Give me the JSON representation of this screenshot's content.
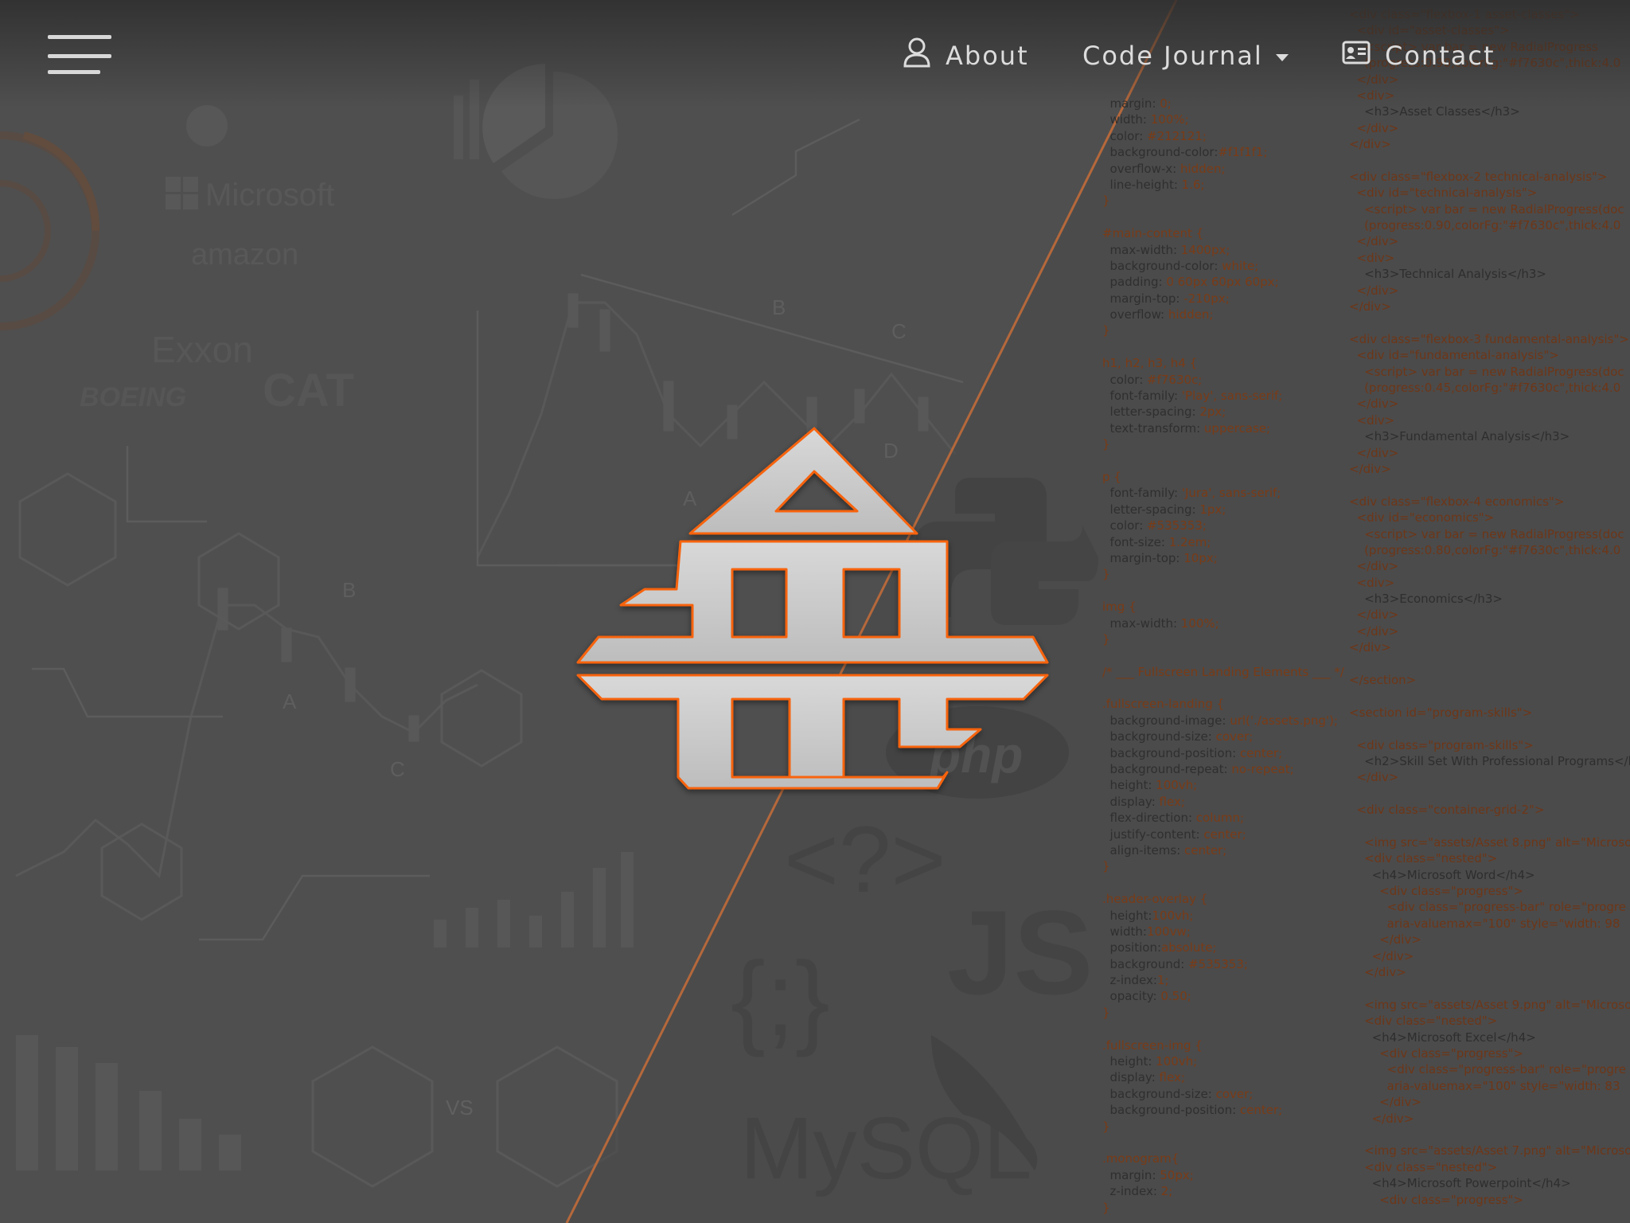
{
  "nav": {
    "menu_icon": "hamburger-menu-icon",
    "items": [
      {
        "label": "About",
        "icon": "user-icon"
      },
      {
        "label": "Code Journal",
        "icon": "chevron-down-icon"
      },
      {
        "label": "Contact",
        "icon": "contact-card-icon"
      }
    ]
  },
  "brand": {
    "monogram_icon": "site-monogram-logo",
    "accent_color": "#f7630c",
    "logo_fill": "#cfcfcf"
  },
  "background": {
    "company_logos": [
      "Microsoft",
      "amazon",
      "Exxon",
      "BOEING",
      "CAT"
    ],
    "tech_logos": [
      "python-logo",
      "php-logo",
      "js-logo",
      "mysql-logo",
      "php-tag-logo",
      "braces-logo"
    ],
    "tech_labels": {
      "php": "php",
      "php_tag": "<?>",
      "braces": "{;}",
      "js": "JS",
      "mysql": "MySQL"
    },
    "chart_labels": [
      "B",
      "A",
      "C",
      "B",
      "A",
      "C",
      "D",
      "D",
      "VS"
    ]
  },
  "css_code": [
    [
      "",
      "margin: ",
      "0;"
    ],
    [
      "",
      "width: ",
      "100%;"
    ],
    [
      "",
      "color: ",
      "#212121;"
    ],
    [
      "",
      "background-color:",
      "#f1f1f1;"
    ],
    [
      "",
      "overflow-x: ",
      "hidden;"
    ],
    [
      "",
      "line-height: ",
      "1.6;"
    ],
    [
      "}",
      "",
      ""
    ],
    [
      "",
      "",
      ""
    ],
    [
      "#main-content {",
      "",
      ""
    ],
    [
      "",
      "max-width: ",
      "1400px;"
    ],
    [
      "",
      "background-color: ",
      "white;"
    ],
    [
      "",
      "padding: ",
      "0 60px 60px 60px;"
    ],
    [
      "",
      "margin-top: ",
      "-210px;"
    ],
    [
      "",
      "overflow: ",
      "hidden;"
    ],
    [
      "}",
      "",
      ""
    ],
    [
      "",
      "",
      ""
    ],
    [
      "h1, h2, h3, h4 {",
      "",
      ""
    ],
    [
      "",
      "color: ",
      "#f7630c;"
    ],
    [
      "",
      "font-family: ",
      "'Play', sans-serif;"
    ],
    [
      "",
      "letter-spacing: ",
      "2px;"
    ],
    [
      "",
      "text-transform: ",
      "uppercase;"
    ],
    [
      "}",
      "",
      ""
    ],
    [
      "",
      "",
      ""
    ],
    [
      "p {",
      "",
      ""
    ],
    [
      "",
      "font-family: ",
      "'Jura', sans-serif;"
    ],
    [
      "",
      "letter-spacing: ",
      "1px;"
    ],
    [
      "",
      "color: ",
      "#535353;"
    ],
    [
      "",
      "font-size: ",
      "1.2em;"
    ],
    [
      "",
      "margin-top: ",
      "10px;"
    ],
    [
      "}",
      "",
      ""
    ],
    [
      "",
      "",
      ""
    ],
    [
      "img {",
      "",
      ""
    ],
    [
      "",
      "max-width: ",
      "100%;"
    ],
    [
      "}",
      "",
      ""
    ],
    [
      "",
      "",
      ""
    ],
    [
      "/* ___ Fullscreen Landing Elements ___ */",
      "",
      ""
    ],
    [
      "",
      "",
      ""
    ],
    [
      ".fullscreen-landing {",
      "",
      ""
    ],
    [
      "",
      "background-image: ",
      "url('./assets.png');"
    ],
    [
      "",
      "background-size: ",
      "cover;"
    ],
    [
      "",
      "background-position: ",
      "center;"
    ],
    [
      "",
      "background-repeat: ",
      "no-repeat;"
    ],
    [
      "",
      "height: ",
      "100vh;"
    ],
    [
      "",
      "display: ",
      "flex;"
    ],
    [
      "",
      "flex-direction: ",
      "column;"
    ],
    [
      "",
      "justify-content: ",
      "center;"
    ],
    [
      "",
      "align-items: ",
      "center;"
    ],
    [
      "}",
      "",
      ""
    ],
    [
      "",
      "",
      ""
    ],
    [
      ".header-overlay {",
      "",
      ""
    ],
    [
      "",
      "height:",
      "100vh;"
    ],
    [
      "",
      "width:",
      "100vw;"
    ],
    [
      "",
      "position:",
      "absolute;"
    ],
    [
      "",
      "background: ",
      "#535353;"
    ],
    [
      "",
      "z-index:",
      "1;"
    ],
    [
      "",
      "opacity: ",
      "0.50;"
    ],
    [
      "}",
      "",
      ""
    ],
    [
      "",
      "",
      ""
    ],
    [
      ".fullscreen-img {",
      "",
      ""
    ],
    [
      "",
      "height: ",
      "100vh;"
    ],
    [
      "",
      "display: ",
      "flex;"
    ],
    [
      "",
      "background-size: ",
      "cover;"
    ],
    [
      "",
      "background-position: ",
      "center;"
    ],
    [
      "}",
      "",
      ""
    ],
    [
      "",
      "",
      ""
    ],
    [
      ".monogram{",
      "",
      ""
    ],
    [
      "",
      "margin: ",
      "50px;"
    ],
    [
      "",
      "z-index: ",
      "2;"
    ],
    [
      "}",
      "",
      ""
    ]
  ],
  "html_code": [
    "<div class=\"flexbox-1 asset-classes\">",
    "  <div id=\"asset-classes\">",
    "    <script> var bar = new RadialProgress",
    "    (progress:0.90,colorFg:\"#f7630c\",thick:4.0",
    "  </div>",
    "  <div>",
    "    <h3>Asset Classes</h3>",
    "  </div>",
    "</div>",
    "",
    "<div class=\"flexbox-2 technical-analysis\">",
    "  <div id=\"technical-analysis\">",
    "    <script> var bar = new RadialProgress(doc",
    "    (progress:0.90,colorFg:\"#f7630c\",thick:4.0",
    "  </div>",
    "  <div>",
    "    <h3>Technical Analysis</h3>",
    "  </div>",
    "</div>",
    "",
    "<div class=\"flexbox-3 fundamental-analysis\">",
    "  <div id=\"fundamental-analysis\">",
    "    <script> var bar = new RadialProgress(doc",
    "    (progress:0.45,colorFg:\"#f7630c\",thick:4.0",
    "  </div>",
    "  <div>",
    "    <h3>Fundamental Analysis</h3>",
    "  </div>",
    "</div>",
    "",
    "<div class=\"flexbox-4 economics\">",
    "  <div id=\"economics\">",
    "    <script> var bar = new RadialProgress(doc",
    "    (progress:0.80,colorFg:\"#f7630c\",thick:4.0",
    "  </div>",
    "  <div>",
    "    <h3>Economics</h3>",
    "  </div>",
    "  </div>",
    "</div>",
    "",
    "</section>",
    "",
    "<section id=\"program-skills\">",
    "",
    "  <div class=\"program-skills\">",
    "    <h2>Skill Set With Professional Programs</h2>",
    "  </div>",
    "",
    "  <div class=\"container-grid-2\">",
    "",
    "    <img src=\"assets/Asset 8.png\" alt=\"Microsoft",
    "    <div class=\"nested\">",
    "      <h4>Microsoft Word</h4>",
    "        <div class=\"progress\">",
    "          <div class=\"progress-bar\" role=\"progre",
    "          aria-valuemax=\"100\" style=\"width: 98",
    "        </div>",
    "      </div>",
    "    </div>",
    "",
    "    <img src=\"assets/Asset 9.png\" alt=\"Microsoft",
    "    <div class=\"nested\">",
    "      <h4>Microsoft Excel</h4>",
    "        <div class=\"progress\">",
    "          <div class=\"progress-bar\" role=\"progre",
    "          aria-valuemax=\"100\" style=\"width: 83",
    "        </div>",
    "      </div>",
    "",
    "    <img src=\"assets/Asset 7.png\" alt=\"Microsoft",
    "    <div class=\"nested\">",
    "      <h4>Microsoft Powerpoint</h4>",
    "        <div class=\"progress\">"
  ]
}
